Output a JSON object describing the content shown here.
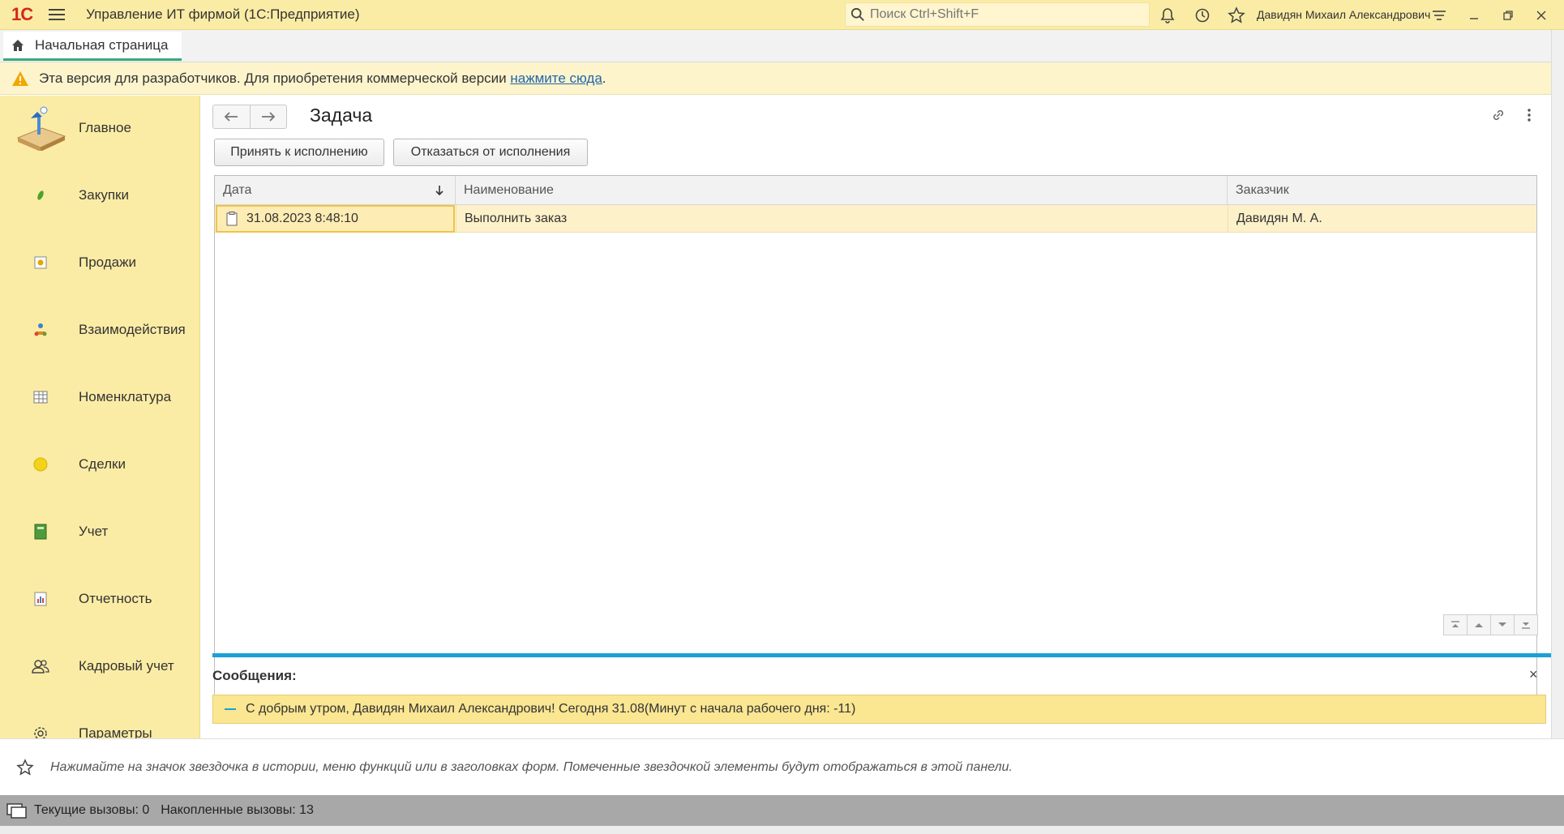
{
  "app": {
    "title": "Управление ИТ фирмой  (1С:Предприятие)",
    "logo_text": "1С",
    "search_placeholder": "Поиск Ctrl+Shift+F",
    "user_name": "Давидян Михаил Александрович"
  },
  "tabs": {
    "home_label": "Начальная страница"
  },
  "notice": {
    "text": "Эта версия для разработчиков. Для приобретения коммерческой версии ",
    "link": "нажмите сюда",
    "suffix": "."
  },
  "sidebar": {
    "items": [
      {
        "label": "Главное",
        "icon": "desk-lamp-icon"
      },
      {
        "label": "Закупки",
        "icon": "leaf-icon"
      },
      {
        "label": "Продажи",
        "icon": "sales-doc-icon"
      },
      {
        "label": "Взаимодействия",
        "icon": "people-icon"
      },
      {
        "label": "Номенклатура",
        "icon": "table-icon"
      },
      {
        "label": "Сделки",
        "icon": "circle-icon"
      },
      {
        "label": "Учет",
        "icon": "ledger-icon"
      },
      {
        "label": "Отчетность",
        "icon": "report-icon"
      },
      {
        "label": "Кадровый учет",
        "icon": "users-icon"
      },
      {
        "label": "Параметры",
        "icon": "gear-icon"
      }
    ]
  },
  "form": {
    "title": "Задача",
    "accept_button": "Принять к исполнению",
    "decline_button": "Отказаться от исполнения",
    "columns": [
      "Дата",
      "Наименование",
      "Заказчик"
    ],
    "rows": [
      {
        "date": "31.08.2023 8:48:10",
        "name": "Выполнить заказ",
        "customer": "Давидян М. А."
      }
    ]
  },
  "messages": {
    "title": "Сообщения:",
    "items": [
      "С добрым утром, Давидян Михаил Александрович! Сегодня 31.08(Минут с начала рабочего дня: -11)"
    ]
  },
  "favorites": {
    "hint": "Нажимайте на значок звездочка в истории, меню функций или в заголовках форм. Помеченные звездочкой элементы будут отображаться в этой панели."
  },
  "status": {
    "current_calls": "Текущие вызовы: 0",
    "accumulated_calls": "Накопленные вызовы: 13"
  },
  "colors": {
    "accent_yellow": "#fbeca5",
    "message_bar": "#1aa0d6",
    "logo_red": "#d6281b"
  }
}
